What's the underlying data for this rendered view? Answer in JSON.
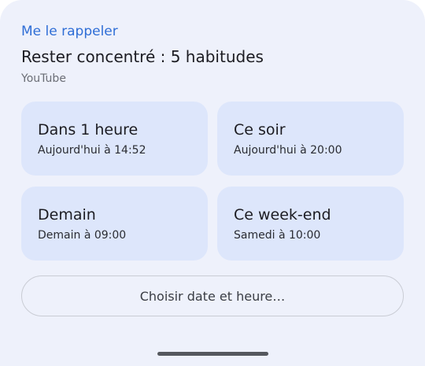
{
  "sheet": {
    "header_label": "Me le rappeler",
    "title": "Rester concentré : 5 habitudes",
    "source": "YouTube"
  },
  "options": [
    {
      "label": "Dans 1 heure",
      "detail": "Aujourd'hui à 14:52"
    },
    {
      "label": "Ce soir",
      "detail": "Aujourd'hui à 20:00"
    },
    {
      "label": "Demain",
      "detail": "Demain à 09:00"
    },
    {
      "label": "Ce week-end",
      "detail": "Samedi à 10:00"
    }
  ],
  "choose_button": {
    "label": "Choisir date et heure…"
  },
  "colors": {
    "accent": "#2f6ed6",
    "sheet_background": "#eef1fb",
    "card_background": "#dde6fb"
  }
}
